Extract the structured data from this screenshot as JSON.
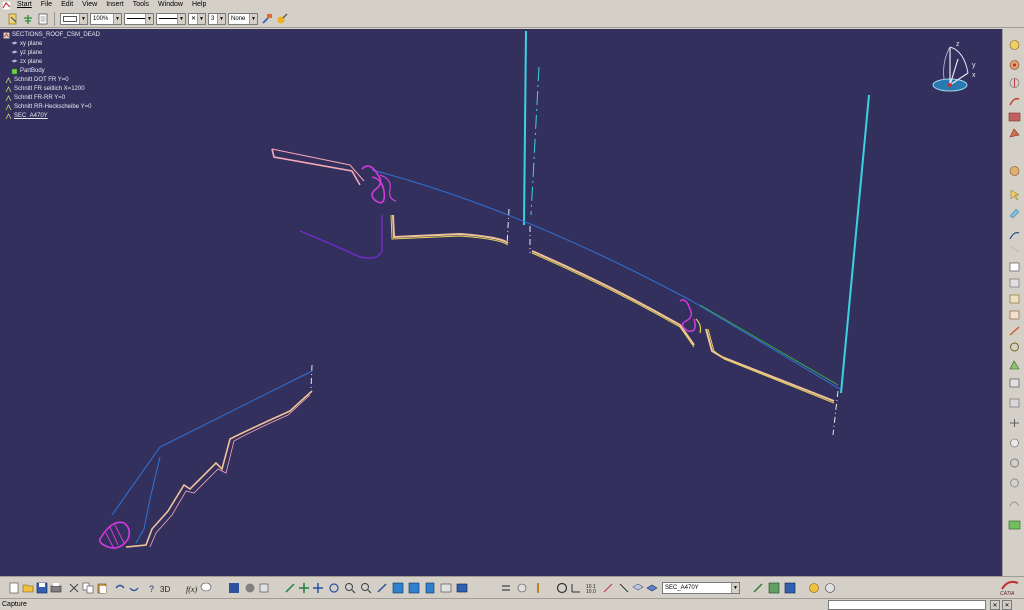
{
  "menu": [
    "Start",
    "File",
    "Edit",
    "View",
    "Insert",
    "Tools",
    "Window",
    "Help"
  ],
  "toolbar": {
    "zoom": "100%",
    "layer_value": "3",
    "render_mode": "None"
  },
  "tree": {
    "root": "SECTIONS_ROOF_CSM_DEAD",
    "items": [
      "xy plane",
      "yz plane",
      "zx plane",
      "PartBody",
      "Schnitt DOT FR Y=0",
      "Schnitt FR seitlich X=1200",
      "Schnitt FR-RR Y=0",
      "Schnitt RR-Heckscheibe Y=0",
      "SEC_A470Y"
    ]
  },
  "compass": {
    "x": "x",
    "y": "y",
    "z": "z"
  },
  "bottom_toolbar": {
    "section_select": "SEC_A470Y"
  },
  "status": {
    "text": "Capture"
  },
  "brand": "CATIA",
  "colors": {
    "viewport_bg": "#34305e",
    "cyan": "#3ad1e0",
    "blue": "#2e74d8",
    "peach": "#f0c39a",
    "magenta": "#d33adc",
    "purple": "#7b2be0",
    "green": "#36a84a",
    "yellow": "#e6d450",
    "pink": "#f6a7b8"
  }
}
